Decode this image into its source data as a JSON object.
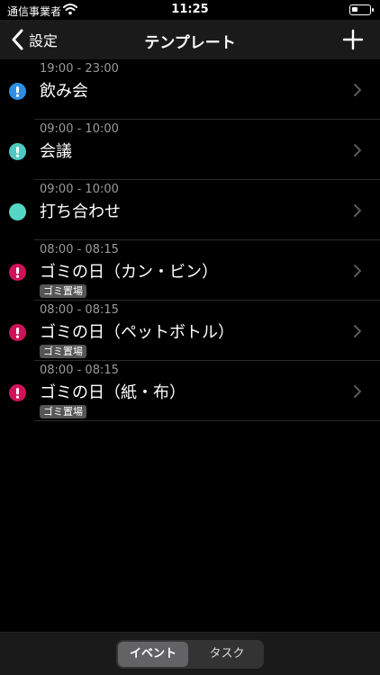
{
  "status": {
    "carrier": "通信事業者",
    "time": "11:25",
    "battery_level": 0.35
  },
  "nav": {
    "back_label": "設定",
    "title": "テンプレート"
  },
  "items": [
    {
      "time": "19:00 - 23:00",
      "title": "飲み会",
      "color": "#2d8fe3",
      "alert": true,
      "tag": ""
    },
    {
      "time": "09:00 - 10:00",
      "title": "会議",
      "color": "#50c9c3",
      "alert": true,
      "tag": ""
    },
    {
      "time": "09:00 - 10:00",
      "title": "打ち合わせ",
      "color": "#56d7c6",
      "alert": false,
      "tag": ""
    },
    {
      "time": "08:00 - 08:15",
      "title": "ゴミの日（カン・ビン）",
      "color": "#d0125a",
      "alert": true,
      "tag": "ゴミ置場"
    },
    {
      "time": "08:00 - 08:15",
      "title": "ゴミの日（ペットボトル）",
      "color": "#d0125a",
      "alert": true,
      "tag": "ゴミ置場"
    },
    {
      "time": "08:00 - 08:15",
      "title": "ゴミの日（紙・布）",
      "color": "#d0125a",
      "alert": true,
      "tag": "ゴミ置場"
    }
  ],
  "tabs": {
    "selected": "イベント",
    "other": "タスク"
  },
  "icons": {
    "back": "chevron-left-icon",
    "add": "plus-icon",
    "row": "chevron-right-icon",
    "alert": "exclamation-icon"
  }
}
